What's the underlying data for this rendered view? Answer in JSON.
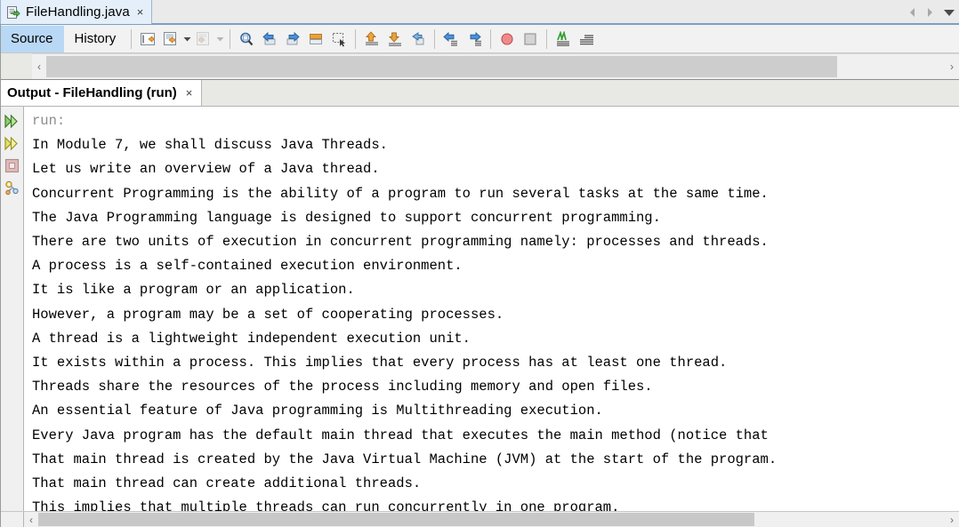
{
  "window": {
    "nav_back_icon": "arrow-left-icon",
    "nav_forward_icon": "arrow-right-icon",
    "dropdown_icon": "chevron-down-icon"
  },
  "editor": {
    "file_tab": {
      "icon": "java-file-icon",
      "title": "FileHandling.java",
      "close_label": "×"
    },
    "mode_tabs": [
      {
        "label": "Source",
        "active": true
      },
      {
        "label": "History",
        "active": false
      }
    ],
    "toolbar": [
      {
        "name": "shift-line-left-icon",
        "enabled": true
      },
      {
        "name": "comment-lines-icon",
        "enabled": true
      },
      {
        "name": "comment-dropdown-caret",
        "enabled": true
      },
      {
        "name": "uncomment-lines-icon",
        "enabled": false
      },
      {
        "name": "uncomment-dropdown-caret",
        "enabled": false
      },
      {
        "name": "find-selection-icon",
        "enabled": true
      },
      {
        "name": "previous-bookmark-icon",
        "enabled": true
      },
      {
        "name": "next-bookmark-icon",
        "enabled": true
      },
      {
        "name": "toggle-bookmark-icon",
        "enabled": true
      },
      {
        "name": "toggle-rectangular-selection-icon",
        "enabled": true
      },
      {
        "name": "previous-error-icon",
        "enabled": true
      },
      {
        "name": "next-error-icon",
        "enabled": true
      },
      {
        "name": "last-edit-icon",
        "enabled": true
      },
      {
        "name": "shift-left-icon",
        "enabled": true
      },
      {
        "name": "shift-right-icon",
        "enabled": true
      },
      {
        "name": "toggle-breakpoint-icon",
        "enabled": true
      },
      {
        "name": "stop-icon",
        "enabled": true
      },
      {
        "name": "toggle-highlight-icon",
        "enabled": true
      },
      {
        "name": "toggle-text-limit-icon",
        "enabled": true
      }
    ],
    "hscroll": {
      "left_arrow": "‹",
      "right_arrow": "›",
      "thumb_start_pct": 0,
      "thumb_width_pct": 88
    }
  },
  "output": {
    "tab": {
      "title": "Output - FileHandling (run)",
      "close_label": "×"
    },
    "sidebar": [
      {
        "name": "rerun-icon"
      },
      {
        "name": "rerun-alt-icon"
      },
      {
        "name": "stop-process-icon"
      },
      {
        "name": "output-settings-icon"
      }
    ],
    "lines": [
      {
        "text": "run:",
        "muted": true
      },
      {
        "text": "In Module 7, we shall discuss Java Threads.",
        "muted": false
      },
      {
        "text": "Let us write an overview of a Java thread.",
        "muted": false
      },
      {
        "text": "Concurrent Programming is the ability of a program to run several tasks at the same time.",
        "muted": false
      },
      {
        "text": "The Java Programming language is designed to support concurrent programming.",
        "muted": false
      },
      {
        "text": "There are two units of execution in concurrent programming namely: processes and threads.",
        "muted": false
      },
      {
        "text": "A process is a self-contained execution environment.",
        "muted": false
      },
      {
        "text": "It is like a program or an application.",
        "muted": false
      },
      {
        "text": "However, a program may be a set of cooperating processes.",
        "muted": false
      },
      {
        "text": "A thread is a lightweight independent execution unit.",
        "muted": false
      },
      {
        "text": "It exists within a process. This implies that every process has at least one thread.",
        "muted": false
      },
      {
        "text": "Threads share the resources of the process including memory and open files.",
        "muted": false
      },
      {
        "text": "An essential feature of Java programming is Multithreading execution.",
        "muted": false
      },
      {
        "text": "Every Java program has the default main thread that executes the main method (notice that",
        "muted": false
      },
      {
        "text": "That main thread is created by the Java Virtual Machine (JVM) at the start of the program.",
        "muted": false
      },
      {
        "text": "That main thread can create additional threads.",
        "muted": false
      },
      {
        "text": "This implies that multiple threads can run concurrently in one program.",
        "muted": false
      }
    ],
    "hscroll": {
      "left_arrow": "‹",
      "right_arrow": "›",
      "thumb_start_pct": 0,
      "thumb_width_pct": 79
    }
  },
  "colors": {
    "tab_active": "#e4effa",
    "mode_tab_active": "#b8d8f5",
    "output_text": "#000000",
    "output_muted": "#8c8c8c",
    "scrollbar_thumb": "#cdcdcd",
    "panel_bg": "#f0f0f0"
  }
}
